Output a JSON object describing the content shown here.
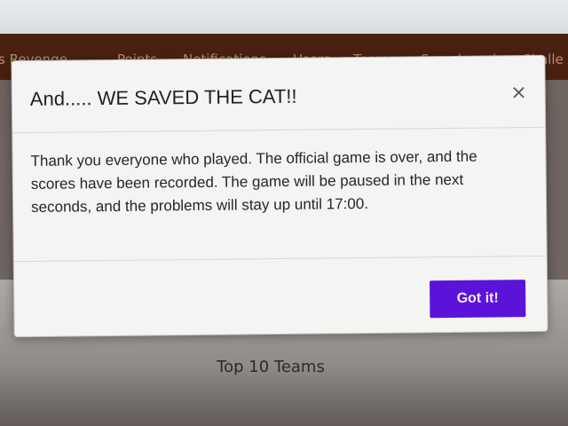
{
  "navbar": {
    "items": [
      "s Revenge",
      "Points",
      "Notifications",
      "Users",
      "Teams",
      "Scoreboard",
      "Challe"
    ]
  },
  "modal": {
    "title": "And..... WE SAVED THE CAT!!",
    "close_icon": "×",
    "body": "Thank you everyone who played. The official game is over, and the scores have been recorded. The game will be paused in the next seconds, and the problems will stay up until 17:00.",
    "button_label": "Got it!",
    "button_color": "#5b13d9"
  },
  "page": {
    "section_title": "Top 10 Teams"
  }
}
